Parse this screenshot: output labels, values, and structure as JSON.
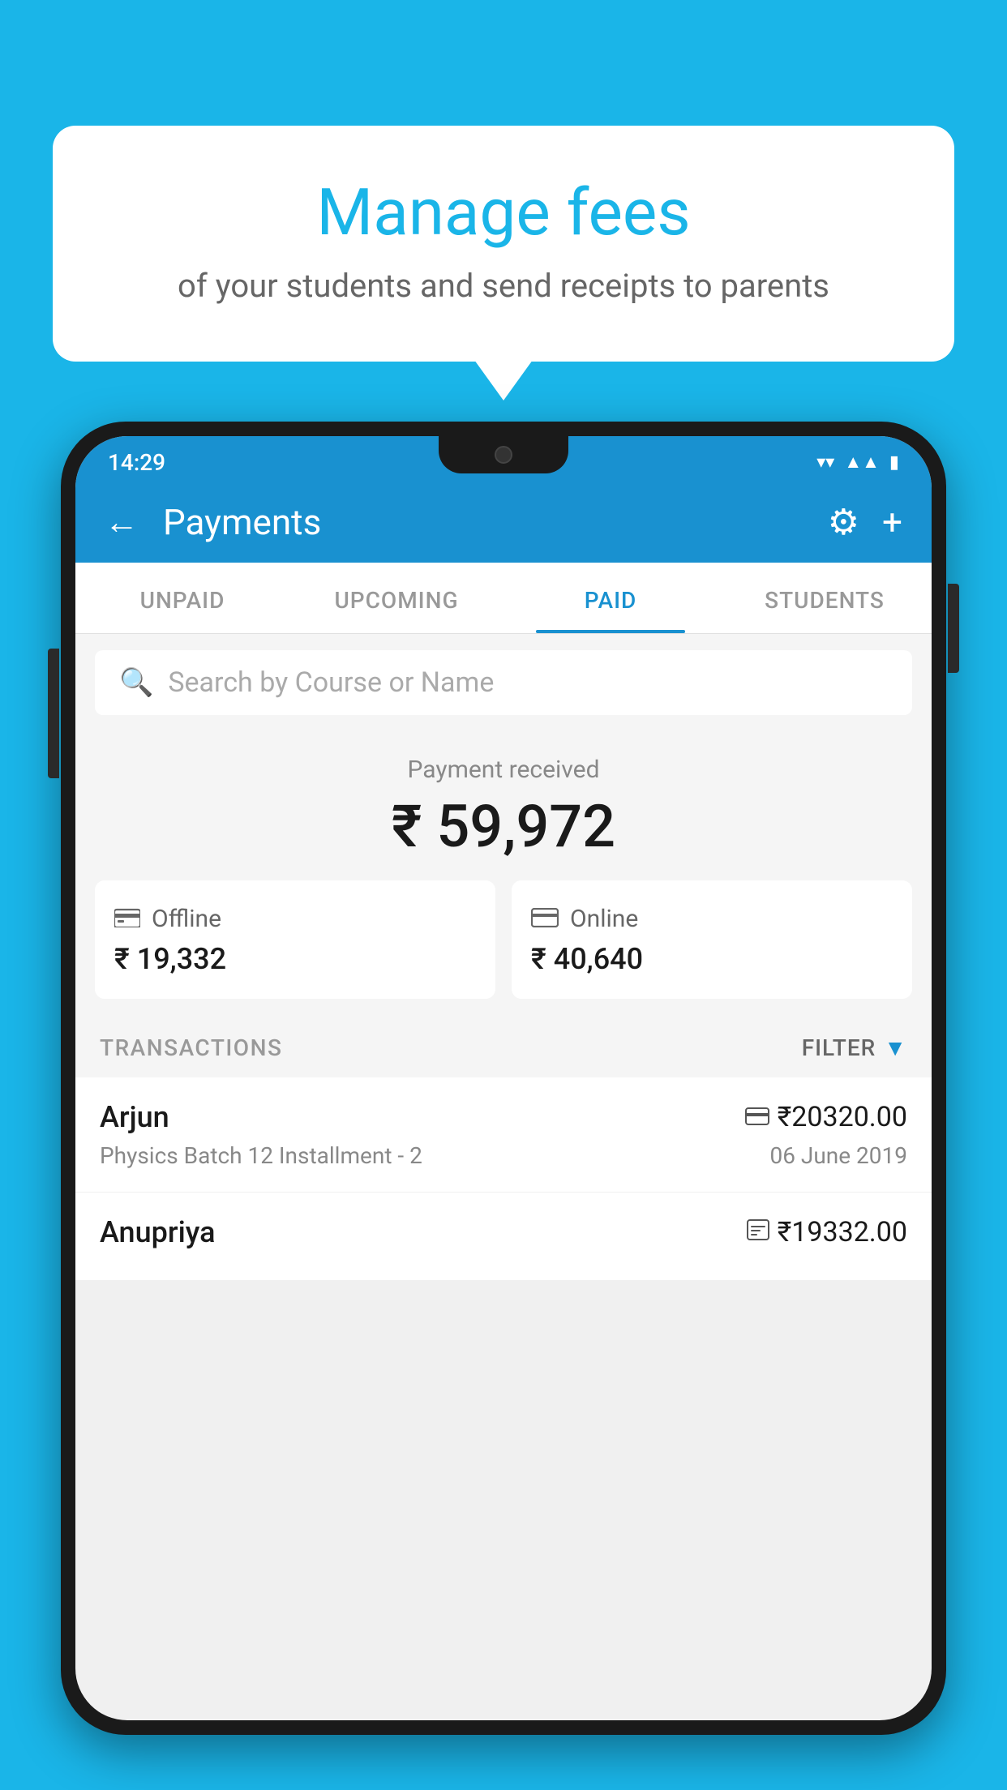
{
  "background_color": "#1ab5e8",
  "bubble": {
    "title": "Manage fees",
    "subtitle": "of your students and send receipts to parents"
  },
  "status_bar": {
    "time": "14:29",
    "wifi_icon": "▼",
    "signal_icon": "▲",
    "battery_icon": "▮"
  },
  "header": {
    "title": "Payments",
    "back_label": "←",
    "gear_label": "⚙",
    "plus_label": "+"
  },
  "tabs": [
    {
      "label": "UNPAID",
      "active": false
    },
    {
      "label": "UPCOMING",
      "active": false
    },
    {
      "label": "PAID",
      "active": true
    },
    {
      "label": "STUDENTS",
      "active": false
    }
  ],
  "search": {
    "placeholder": "Search by Course or Name"
  },
  "payment_summary": {
    "label": "Payment received",
    "total": "₹ 59,972",
    "offline_label": "Offline",
    "offline_amount": "₹ 19,332",
    "online_label": "Online",
    "online_amount": "₹ 40,640"
  },
  "transactions": {
    "section_label": "TRANSACTIONS",
    "filter_label": "FILTER",
    "items": [
      {
        "name": "Arjun",
        "description": "Physics Batch 12 Installment - 2",
        "amount": "₹20320.00",
        "date": "06 June 2019",
        "type_icon": "💳"
      },
      {
        "name": "Anupriya",
        "description": "",
        "amount": "₹19332.00",
        "date": "",
        "type_icon": "🧾"
      }
    ]
  }
}
